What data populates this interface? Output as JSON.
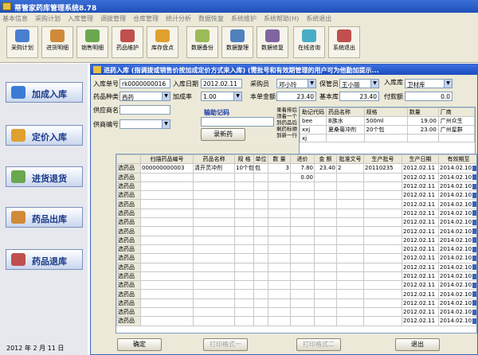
{
  "app_title": "蒂管家药库管理系统8.78",
  "menu": [
    "基本信息",
    "采购计划",
    "入库管理",
    "调拨管理",
    "仓库管理",
    "统计分析",
    "数据恢复",
    "系统维护",
    "系统帮助(H)",
    "系统退出"
  ],
  "toolbar": [
    {
      "label": "采购计划",
      "icon": "purchase-plan-icon",
      "color": "#4a7fd0"
    },
    {
      "label": "进货明细",
      "icon": "stock-detail-icon",
      "color": "#d08a3a"
    },
    {
      "label": "销售明细",
      "icon": "sales-detail-icon",
      "color": "#6aa84f"
    },
    {
      "label": "药品维护",
      "icon": "drug-maintain-icon",
      "color": "#c0504d"
    },
    {
      "label": "库存盘点",
      "icon": "inventory-icon",
      "color": "#e0a030"
    },
    {
      "label": "数据备份",
      "icon": "backup-icon",
      "color": "#9bbb59"
    },
    {
      "label": "数据整理",
      "icon": "data-organize-icon",
      "color": "#4f81bd"
    },
    {
      "label": "数据修复",
      "icon": "data-repair-icon",
      "color": "#8064a2"
    },
    {
      "label": "在线咨询",
      "icon": "online-help-icon",
      "color": "#4bacc6"
    },
    {
      "label": "系统退出",
      "icon": "exit-icon",
      "color": "#c0504d"
    }
  ],
  "sidebar": [
    {
      "label": "加成入库",
      "icon": "markup-in-icon",
      "color": "#3a7bd5"
    },
    {
      "label": "定价入库",
      "icon": "price-in-icon",
      "color": "#e0a030"
    },
    {
      "label": "进货退货",
      "icon": "return-goods-icon",
      "color": "#6aa84f"
    },
    {
      "label": "药品出库",
      "icon": "drug-out-icon",
      "color": "#d08a3a"
    },
    {
      "label": "药品退库",
      "icon": "drug-return-icon",
      "color": "#c0504d"
    }
  ],
  "date_year": "2012 年",
  "date_month": "2 月",
  "date_day": "11 日",
  "dialog": {
    "title": "进药入库 (指调拨或销售价按加成定价方式来入库) (需批号和有效期管理的用户可为他勤加提示...",
    "form": {
      "voucher_label": "入库单号",
      "voucher_value": "rk0000000016",
      "date_label": "入库日期",
      "date_value": "2012.02.11",
      "buyer_label": "采购员",
      "buyer_value": "邓小玲",
      "keeper_label": "保管员",
      "keeper_value": "王小丽",
      "warehouse_label": "入库库",
      "warehouse_value": "卫材库",
      "category_label": "药品种类",
      "category_value": "西药",
      "markup_label": "加成率",
      "markup_value": "1.00",
      "amount_label": "本单金额",
      "amount_value": "23.40",
      "this_amount_label": "基本库",
      "this_amount_value": "23.40",
      "payment_label": "付款额",
      "payment_value": "0.0",
      "supplier_label": "供应商名",
      "input_code_label": "输助记码",
      "supplier_no_label": "供商编号",
      "record_button": "录新药"
    },
    "hint": "录着排后须着一个到药品后剩药标顺到新一行",
    "lookup_headers": [
      "助记代码",
      "药品名称",
      "规格",
      "数量",
      "厂商"
    ],
    "lookup_rows": [
      [
        "bee",
        "B族水",
        "500ml",
        "19.00",
        "广州众生"
      ],
      [
        "xxj",
        "夏桑菊冲剂",
        "20个包",
        "23.00",
        "广州星群"
      ],
      [
        "xj",
        "",
        "",
        "",
        ""
      ]
    ],
    "grid_headers": [
      "",
      "扫描药品编号",
      "药品名称",
      "规 格",
      "单位",
      "数 量",
      "进价",
      "金 额",
      "批准文号",
      "生产批号",
      "生产日期",
      "有效期至"
    ],
    "grid_rows": [
      [
        "选药品",
        "000000000003",
        "清开灵冲剂",
        "10个包",
        "包",
        "3",
        "7.80",
        "23.40",
        "2",
        "20110235",
        "2012.02.11",
        "2014.02.10"
      ],
      [
        "选药品",
        "",
        "",
        "",
        "",
        "",
        "0.00",
        "",
        "",
        "",
        "2012.02.11",
        "2014.02.10"
      ],
      [
        "选药品",
        "",
        "",
        "",
        "",
        "",
        "",
        "",
        "",
        "",
        "2012.02.11",
        "2014.02.10"
      ],
      [
        "选药品",
        "",
        "",
        "",
        "",
        "",
        "",
        "",
        "",
        "",
        "2012.02.11",
        "2014.02.10"
      ],
      [
        "选药品",
        "",
        "",
        "",
        "",
        "",
        "",
        "",
        "",
        "",
        "2012.02.11",
        "2014.02.10"
      ],
      [
        "选药品",
        "",
        "",
        "",
        "",
        "",
        "",
        "",
        "",
        "",
        "2012.02.11",
        "2014.02.10"
      ],
      [
        "选药品",
        "",
        "",
        "",
        "",
        "",
        "",
        "",
        "",
        "",
        "2012.02.11",
        "2014.02.10"
      ],
      [
        "选药品",
        "",
        "",
        "",
        "",
        "",
        "",
        "",
        "",
        "",
        "2012.02.11",
        "2014.02.10"
      ],
      [
        "选药品",
        "",
        "",
        "",
        "",
        "",
        "",
        "",
        "",
        "",
        "2012.02.11",
        "2014.02.10"
      ],
      [
        "选药品",
        "",
        "",
        "",
        "",
        "",
        "",
        "",
        "",
        "",
        "2012.02.11",
        "2014.02.10"
      ],
      [
        "选药品",
        "",
        "",
        "",
        "",
        "",
        "",
        "",
        "",
        "",
        "2012.02.11",
        "2014.02.10"
      ],
      [
        "选药品",
        "",
        "",
        "",
        "",
        "",
        "",
        "",
        "",
        "",
        "2012.02.11",
        "2014.02.10"
      ],
      [
        "选药品",
        "",
        "",
        "",
        "",
        "",
        "",
        "",
        "",
        "",
        "2012.02.11",
        "2014.02.10"
      ],
      [
        "选药品",
        "",
        "",
        "",
        "",
        "",
        "",
        "",
        "",
        "",
        "2012.02.11",
        "2014.02.10"
      ],
      [
        "选药品",
        "",
        "",
        "",
        "",
        "",
        "",
        "",
        "",
        "",
        "2012.02.11",
        "2014.02.10"
      ],
      [
        "选药品",
        "",
        "",
        "",
        "",
        "",
        "",
        "",
        "",
        "",
        "2012.02.11",
        "2014.02.10"
      ],
      [
        "选药品",
        "",
        "",
        "",
        "",
        "",
        "",
        "",
        "",
        "",
        "2012.02.11",
        "2014.02.10"
      ],
      [
        "选药品",
        "",
        "",
        "",
        "",
        "",
        "",
        "",
        "",
        "",
        "2012.02.11",
        "2014.02.10"
      ]
    ],
    "buttons": {
      "confirm": "确定",
      "print1": "打印格式一",
      "print2": "打印格式二",
      "exit": "退出"
    }
  }
}
